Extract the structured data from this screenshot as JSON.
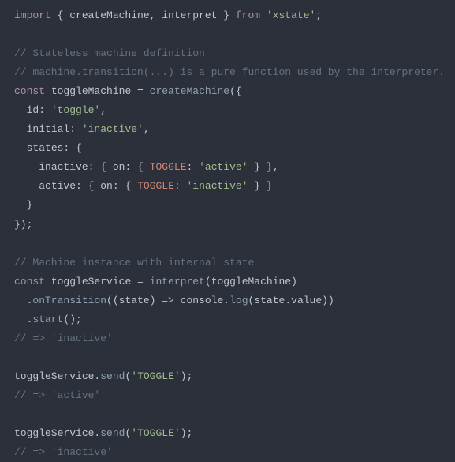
{
  "lines": {
    "l1_import": "import",
    "l1_brace_open": " { ",
    "l1_createMachine": "createMachine",
    "l1_comma": ", ",
    "l1_interpret": "interpret",
    "l1_brace_close": " } ",
    "l1_from": "from",
    "l1_space": " ",
    "l1_str": "'xstate'",
    "l1_semi": ";",
    "l3_comment": "// Stateless machine definition",
    "l4_comment": "// machine.transition(...) is a pure function used by the interpreter.",
    "l5_const": "const",
    "l5_space1": " ",
    "l5_name": "toggleMachine",
    "l5_eq": " = ",
    "l5_fn": "createMachine",
    "l5_open": "({",
    "l6_indent": "  ",
    "l6_key": "id",
    "l6_colon": ": ",
    "l6_val": "'toggle'",
    "l6_comma": ",",
    "l7_indent": "  ",
    "l7_key": "initial",
    "l7_colon": ": ",
    "l7_val": "'inactive'",
    "l7_comma": ",",
    "l8_indent": "  ",
    "l8_key": "states",
    "l8_colon": ": {",
    "l9_indent": "    ",
    "l9_key": "inactive",
    "l9_colon": ": { ",
    "l9_on": "on",
    "l9_colon2": ": { ",
    "l9_toggle": "TOGGLE",
    "l9_colon3": ": ",
    "l9_val": "'active'",
    "l9_close": " } },",
    "l10_indent": "    ",
    "l10_key": "active",
    "l10_colon": ": { ",
    "l10_on": "on",
    "l10_colon2": ": { ",
    "l10_toggle": "TOGGLE",
    "l10_colon3": ": ",
    "l10_val": "'inactive'",
    "l10_close": " } }",
    "l11": "  }",
    "l12": "});",
    "l14_comment": "// Machine instance with internal state",
    "l15_const": "const",
    "l15_space": " ",
    "l15_name": "toggleService",
    "l15_eq": " = ",
    "l15_fn": "interpret",
    "l15_open": "(",
    "l15_arg": "toggleMachine",
    "l15_close": ")",
    "l16_indent": "  .",
    "l16_fn": "onTransition",
    "l16_open": "((",
    "l16_state": "state",
    "l16_arrow": ") => ",
    "l16_console": "console",
    "l16_dot": ".",
    "l16_log": "log",
    "l16_open2": "(",
    "l16_state2": "state",
    "l16_dot2": ".",
    "l16_value": "value",
    "l16_close": "))",
    "l17_indent": "  .",
    "l17_fn": "start",
    "l17_close": "();",
    "l18_comment": "// => 'inactive'",
    "l20_name": "toggleService",
    "l20_dot": ".",
    "l20_fn": "send",
    "l20_open": "(",
    "l20_str": "'TOGGLE'",
    "l20_close": ");",
    "l21_comment": "// => 'active'",
    "l23_name": "toggleService",
    "l23_dot": ".",
    "l23_fn": "send",
    "l23_open": "(",
    "l23_str": "'TOGGLE'",
    "l23_close": ");",
    "l24_comment": "// => 'inactive'"
  }
}
